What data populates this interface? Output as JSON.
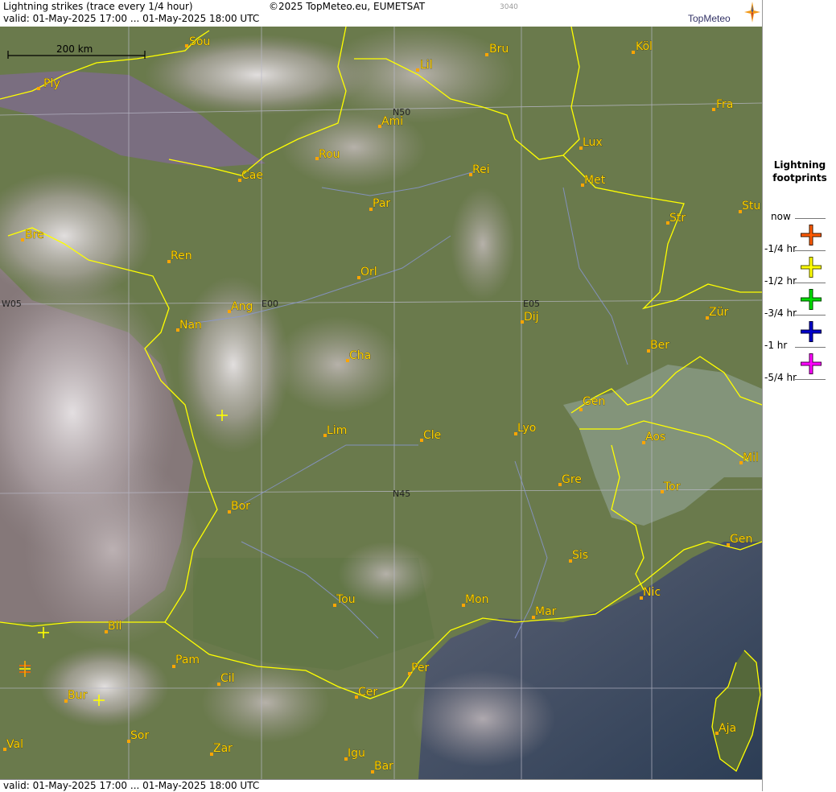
{
  "header": {
    "title": "Lightning strikes (trace every 1/4 hour)",
    "copyright": "©2025 TopMeteo.eu, EUMETSAT",
    "code": "3040",
    "valid": "valid:  01-May-2025 17:00 ... 01-May-2025 18:00 UTC",
    "logo": "TopMeteo"
  },
  "footer": {
    "valid": "valid:  01-May-2025 17:00 ... 01-May-2025 18:00 UTC"
  },
  "map": {
    "scale_label": "200 km",
    "grid_labels": [
      "N50",
      "N45",
      "W05",
      "E00",
      "E05"
    ],
    "cities": [
      "Sou",
      "Bru",
      "Köl",
      "Lil",
      "Ply",
      "Ami",
      "Fra",
      "Lux",
      "Rou",
      "Cae",
      "Rei",
      "Met",
      "Par",
      "Stu",
      "Str",
      "Bre",
      "Ren",
      "Orl",
      "Zür",
      "Ang",
      "Dij",
      "Nan",
      "Ber",
      "Cha",
      "Gen",
      "Lim",
      "Cle",
      "Lyo",
      "Aos",
      "Mil",
      "Gre",
      "Tor",
      "Bor",
      "Gen",
      "Sis",
      "Nic",
      "Tou",
      "Mon",
      "Mar",
      "Bil",
      "Pam",
      "Per",
      "Cil",
      "Cer",
      "Bur",
      "Sor",
      "Aja",
      "Val",
      "Zar",
      "Igu",
      "Bar"
    ],
    "strike_colors": {
      "yellow": "#ffff00",
      "orange": "#ff6600"
    }
  },
  "legend": {
    "title_line1": "Lightning",
    "title_line2": "footprints",
    "entries": [
      {
        "label": "now",
        "color": ""
      },
      {
        "label": "-1/4 hr",
        "color": "#ff5a00"
      },
      {
        "label": "-1/2 hr",
        "color": "#ffff00"
      },
      {
        "label": "-3/4 hr",
        "color": "#00dd00"
      },
      {
        "label": "-1 hr",
        "color": "#0000cc"
      },
      {
        "label": "-5/4 hr",
        "color": "#ff00ff"
      }
    ]
  }
}
